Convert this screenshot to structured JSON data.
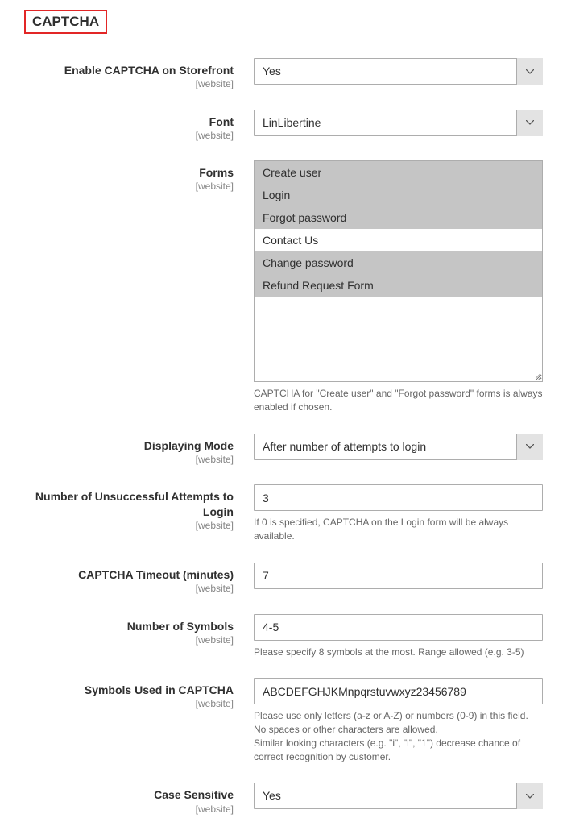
{
  "section": {
    "title": "CAPTCHA",
    "scope_label": "[website]"
  },
  "fields": {
    "enable": {
      "label": "Enable CAPTCHA on Storefront",
      "value": "Yes"
    },
    "font": {
      "label": "Font",
      "value": "LinLibertine"
    },
    "forms": {
      "label": "Forms",
      "options": [
        {
          "label": "Create user",
          "selected": true
        },
        {
          "label": "Login",
          "selected": true
        },
        {
          "label": "Forgot password",
          "selected": true
        },
        {
          "label": "Contact Us",
          "selected": false
        },
        {
          "label": "Change password",
          "selected": true
        },
        {
          "label": "Refund Request Form",
          "selected": true
        }
      ],
      "help": "CAPTCHA for \"Create user\" and \"Forgot password\" forms is always enabled if chosen."
    },
    "mode": {
      "label": "Displaying Mode",
      "value": "After number of attempts to login"
    },
    "attempts": {
      "label": "Number of Unsuccessful Attempts to Login",
      "value": "3",
      "help": "If 0 is specified, CAPTCHA on the Login form will be always available."
    },
    "timeout": {
      "label": "CAPTCHA Timeout (minutes)",
      "value": "7"
    },
    "symbols_count": {
      "label": "Number of Symbols",
      "value": "4-5",
      "help": "Please specify 8 symbols at the most. Range allowed (e.g. 3-5)"
    },
    "symbols_used": {
      "label": "Symbols Used in CAPTCHA",
      "value": "ABCDEFGHJKMnpqrstuvwxyz23456789",
      "help": "Please use only letters (a-z or A-Z) or numbers (0-9) in this field. No spaces or other characters are allowed.\nSimilar looking characters (e.g. \"i\", \"l\", \"1\") decrease chance of correct recognition by customer."
    },
    "case_sensitive": {
      "label": "Case Sensitive",
      "value": "Yes"
    }
  }
}
